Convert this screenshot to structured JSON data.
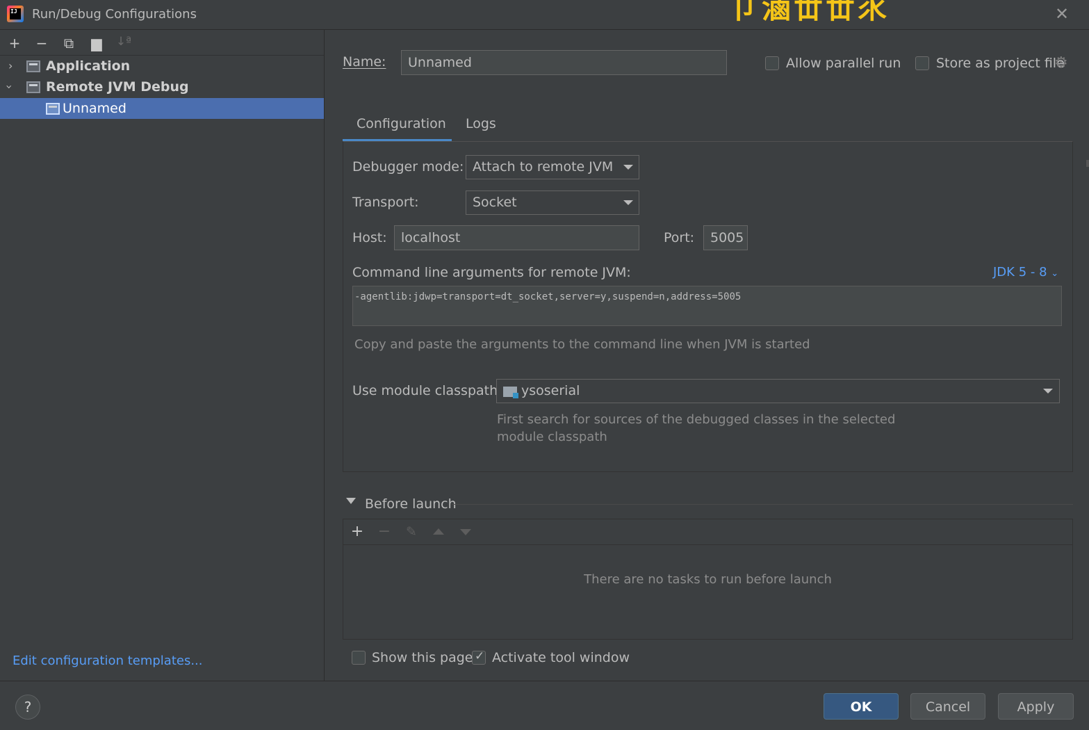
{
  "window": {
    "title": "Run/Debug Configurations",
    "app_icon_text": "IJ"
  },
  "toolbar": {
    "icons": [
      "add-icon",
      "remove-icon",
      "copy-icon",
      "folder-add-icon",
      "sort-icon"
    ]
  },
  "tree": {
    "items": [
      {
        "label": "Application",
        "expanded": false
      },
      {
        "label": "Remote JVM Debug",
        "expanded": true
      },
      {
        "label": "Unnamed",
        "selected": true
      }
    ]
  },
  "sidebar": {
    "edit_templates_link": "Edit configuration templates..."
  },
  "form": {
    "name_label": "Name:",
    "name_value": "Unnamed",
    "allow_parallel_label": "Allow parallel run",
    "allow_parallel_checked": false,
    "store_project_label": "Store as project file",
    "store_project_checked": false
  },
  "tabs": [
    {
      "label": "Configuration",
      "active": true
    },
    {
      "label": "Logs",
      "active": false
    }
  ],
  "config": {
    "debugger_mode_label": "Debugger mode:",
    "debugger_mode_value": "Attach to remote JVM",
    "transport_label": "Transport:",
    "transport_value": "Socket",
    "host_label": "Host:",
    "host_value": "localhost",
    "port_label": "Port:",
    "port_value": "5005",
    "cmd_label": "Command line arguments for remote JVM:",
    "jdk_link": "JDK 5 - 8",
    "cmd_value": "-agentlib:jdwp=transport=dt_socket,server=y,suspend=n,address=5005",
    "cmd_hint": "Copy and paste the arguments to the command line when JVM is started",
    "module_label": "Use module classpath:",
    "module_value": "ysoserial",
    "module_hint_line1": "First search for sources of the debugged classes in the selected",
    "module_hint_line2": "module classpath"
  },
  "before_launch": {
    "title": "Before launch",
    "empty_message": "There are no tasks to run before launch",
    "toolbar_icons": [
      "add-icon",
      "remove-icon",
      "edit-icon",
      "move-up-icon",
      "move-down-icon"
    ]
  },
  "options": {
    "show_page_label": "Show this page",
    "show_page_checked": false,
    "activate_tool_label": "Activate tool window",
    "activate_tool_checked": true
  },
  "footer": {
    "help_label": "?",
    "ok_label": "OK",
    "cancel_label": "Cancel",
    "apply_label": "Apply"
  },
  "colors": {
    "accent": "#4a88c7",
    "selection": "#4b6eaf",
    "link": "#589df6",
    "background": "#3c3f41"
  }
}
